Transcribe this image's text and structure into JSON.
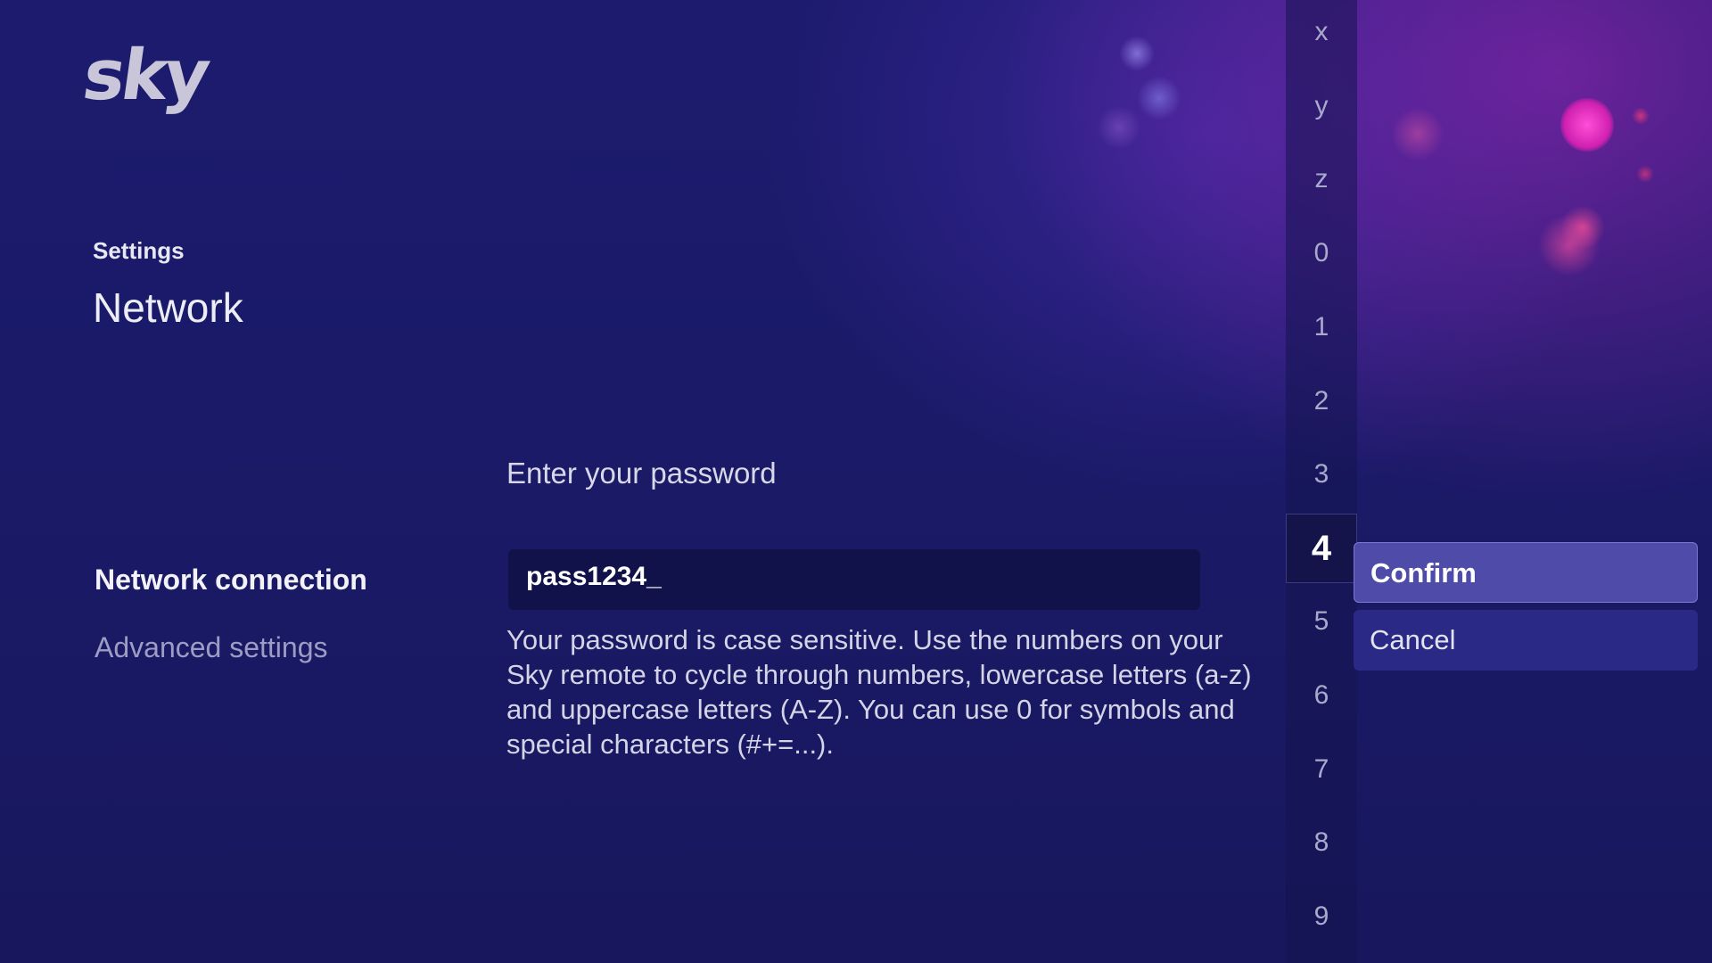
{
  "brand": {
    "logo_text": "sky"
  },
  "header": {
    "breadcrumb": "Settings",
    "title": "Network"
  },
  "sidebar": {
    "items": [
      {
        "label": "Network connection",
        "active": true
      },
      {
        "label": "Advanced settings",
        "active": false
      }
    ]
  },
  "form": {
    "prompt": "Enter your password",
    "password_value": "pass1234_",
    "help_text": "Your password is case sensitive. Use the numbers on your Sky remote to cycle through numbers, lowercase letters (a-z) and uppercase letters (A-Z). You can use 0 for symbols and special characters (#+=...)."
  },
  "keypad": {
    "keys": [
      "x",
      "y",
      "z",
      "0",
      "1",
      "2",
      "3",
      "4",
      "5",
      "6",
      "7",
      "8",
      "9"
    ],
    "selected_key": "4"
  },
  "actions": {
    "confirm_label": "Confirm",
    "cancel_label": "Cancel"
  },
  "colors": {
    "background": "#1c1b6e",
    "accent": "#4e4ca8",
    "field": "#12124a"
  }
}
